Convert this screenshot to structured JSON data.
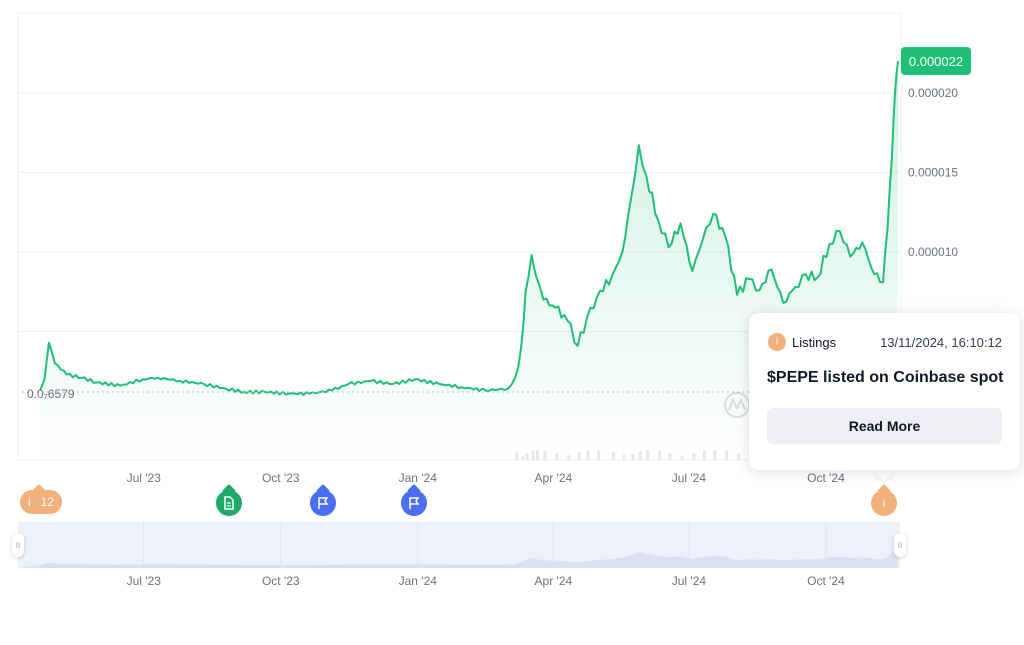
{
  "chart_data": {
    "type": "area",
    "title": "",
    "series": [
      {
        "x": [
          "2023-04-17",
          "2023-04-20",
          "2023-04-23",
          "2023-04-27",
          "2023-05-01",
          "2023-05-05",
          "2023-05-15",
          "2023-05-25",
          "2023-06-10",
          "2023-06-25",
          "2023-07-05",
          "2023-07-20",
          "2023-08-05",
          "2023-08-20",
          "2023-09-01",
          "2023-09-15",
          "2023-10-01",
          "2023-10-15",
          "2023-10-30",
          "2023-11-10",
          "2023-11-25",
          "2023-12-10",
          "2023-12-25",
          "2024-01-10",
          "2024-01-25",
          "2024-02-10",
          "2024-02-25",
          "2024-03-01",
          "2024-03-05",
          "2024-03-08",
          "2024-03-12",
          "2024-03-15",
          "2024-03-20",
          "2024-03-28",
          "2024-04-05",
          "2024-04-12",
          "2024-04-18",
          "2024-04-25",
          "2024-05-05",
          "2024-05-12",
          "2024-05-18",
          "2024-05-23",
          "2024-05-28",
          "2024-06-05",
          "2024-06-12",
          "2024-06-20",
          "2024-06-28",
          "2024-07-05",
          "2024-07-12",
          "2024-07-20",
          "2024-07-28",
          "2024-08-05",
          "2024-08-12",
          "2024-08-20",
          "2024-08-28",
          "2024-09-05",
          "2024-09-12",
          "2024-09-20",
          "2024-09-28",
          "2024-10-05",
          "2024-10-12",
          "2024-10-20",
          "2024-10-28",
          "2024-11-03",
          "2024-11-06",
          "2024-11-09",
          "2024-11-11",
          "2024-11-13"
        ],
        "y": [
          1.3e-06,
          2e-06,
          4.3e-06,
          3e-06,
          2.6e-06,
          2.3e-06,
          2.1e-06,
          1.8e-06,
          1.6e-06,
          2e-06,
          2.1e-06,
          1.9e-06,
          1.7e-06,
          1.4e-06,
          1.2e-06,
          1.2e-06,
          1.1e-06,
          1.1e-06,
          1.3e-06,
          1.7e-06,
          1.9e-06,
          1.7e-06,
          2e-06,
          1.7e-06,
          1.5e-06,
          1.3e-06,
          1.4e-06,
          2.1e-06,
          4e-06,
          7.5e-06,
          9.8e-06,
          8.5e-06,
          7e-06,
          6.5e-06,
          5.7e-06,
          4.1e-06,
          5.8e-06,
          7.2e-06,
          8.5e-06,
          1e-05,
          1.35e-05,
          1.67e-05,
          1.48e-05,
          1.2e-05,
          1.03e-05,
          1.18e-05,
          8.8e-06,
          1.08e-05,
          1.24e-05,
          1.1e-05,
          7.3e-06,
          8.3e-06,
          7.6e-06,
          8.9e-06,
          6.8e-06,
          7.8e-06,
          8.6e-06,
          8.4e-06,
          1.05e-05,
          1.13e-05,
          9.7e-06,
          1.06e-05,
          8.6e-06,
          8.1e-06,
          1.15e-05,
          1.6e-05,
          2e-05,
          2.2e-05
        ]
      }
    ],
    "x_ticks": [
      "Jul '23",
      "Oct '23",
      "Jan '24",
      "Apr '24",
      "Jul '24",
      "Oct '24"
    ],
    "y_ticks": [
      "0.000010",
      "0.000015",
      "0.000020"
    ],
    "ylim": [
      0,
      2.4e-05
    ],
    "grid": true,
    "baseline_label": "0.0₇6579",
    "current_price": "0.000022",
    "colors": {
      "line": "#1fbf75",
      "fill": "#1fbf75",
      "badge": "#1fbf75"
    }
  },
  "events": {
    "listing_group_count": "12",
    "listing_group_icon": "i",
    "listing_icon": "i",
    "markers": [
      {
        "type": "listing-group",
        "icon": "info-icon",
        "color": "#f2b07a"
      },
      {
        "type": "document",
        "icon": "document-icon",
        "color": "#1fa96b"
      },
      {
        "type": "flag",
        "icon": "flag-icon",
        "color": "#4a6ff0"
      },
      {
        "type": "flag",
        "icon": "flag-icon",
        "color": "#4a6ff0"
      },
      {
        "type": "listing",
        "icon": "info-icon",
        "color": "#f2b07a"
      }
    ]
  },
  "tooltip": {
    "category": "Listings",
    "category_icon": "i",
    "datetime": "13/11/2024, 16:10:12",
    "title": "$PEPE listed on Coinbase spot",
    "button_label": "Read More"
  },
  "navigator": {
    "x_ticks": [
      "Jul '23",
      "Oct '23",
      "Jan '24",
      "Apr '24",
      "Jul '24",
      "Oct '24"
    ],
    "handle_label": "II"
  }
}
